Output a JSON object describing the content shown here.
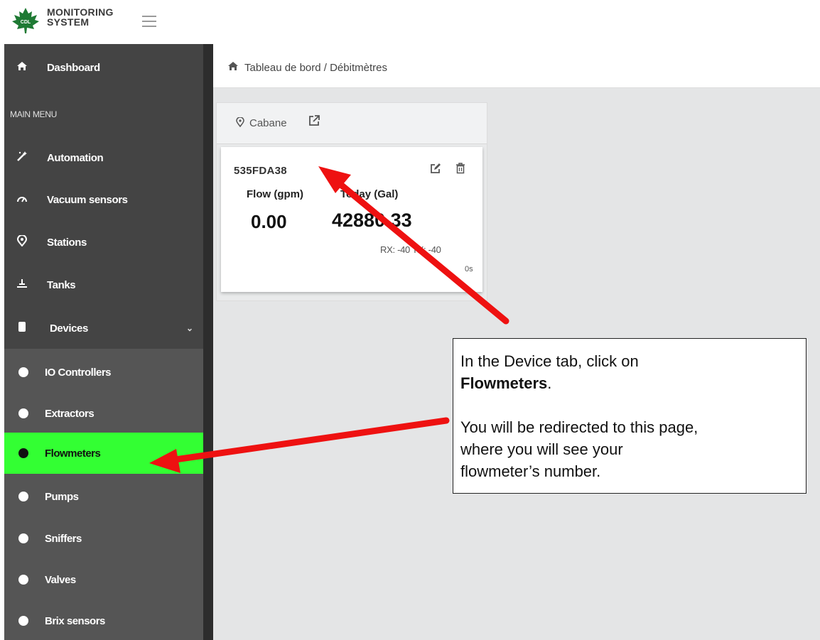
{
  "header": {
    "logo_badge": "CDL",
    "logo_line1": "MONITORING",
    "logo_line2": "SYSTEM",
    "menu_icon": "hamburger-icon"
  },
  "sidebar": {
    "dashboard": {
      "label": "Dashboard",
      "icon": "home-icon"
    },
    "main_menu_heading": "MAIN MENU",
    "items": [
      {
        "label": "Automation",
        "icon": "magic-wand-icon"
      },
      {
        "label": "Vacuum sensors",
        "icon": "gauge-icon"
      },
      {
        "label": "Stations",
        "icon": "map-pin-icon"
      },
      {
        "label": "Tanks",
        "icon": "tank-icon"
      },
      {
        "label": "Devices",
        "icon": "device-icon"
      }
    ],
    "devices_submenu": [
      {
        "label": "IO Controllers",
        "active": false
      },
      {
        "label": "Extractors",
        "active": false
      },
      {
        "label": "Flowmeters",
        "active": true
      },
      {
        "label": "Pumps",
        "active": false
      },
      {
        "label": "Sniffers",
        "active": false
      },
      {
        "label": "Valves",
        "active": false
      },
      {
        "label": "Brix sensors",
        "active": false
      }
    ],
    "active_color": "#33ff33"
  },
  "breadcrumb": {
    "text": "Tableau de bord / Débitmètres"
  },
  "station": {
    "name": "Cabane",
    "device": {
      "id": "535FDA38",
      "flow_label": "Flow (gpm)",
      "today_label": "Today (Gal)",
      "flow_value": "0.00",
      "today_value": "42880.33",
      "signal": "RX: -40 TX: -40",
      "age": "0s"
    }
  },
  "callout": {
    "line1": "In the Device tab, click on",
    "line2_bold": "Flowmeters",
    "line2_end": ".",
    "line3": "You will be redirected to this page,",
    "line4": "where you will see your",
    "line5": "flowmeter’s number."
  },
  "annotation_color": "#ee1111"
}
